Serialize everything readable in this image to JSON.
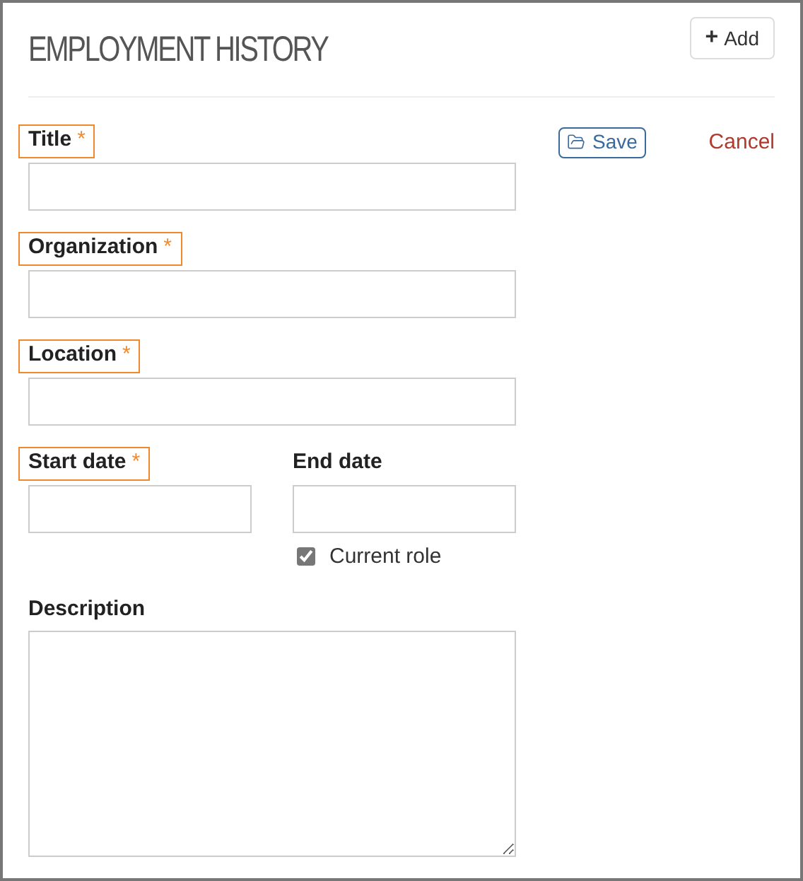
{
  "header": {
    "title": "EMPLOYMENT HISTORY",
    "add_button": {
      "icon": "+",
      "label": "Add"
    }
  },
  "required_mark": "*",
  "actions": {
    "save": "Save",
    "cancel": "Cancel"
  },
  "fields": [
    {
      "label": "Title",
      "required": true
    },
    {
      "label": "Organization",
      "required": true
    },
    {
      "label": "Location",
      "required": true
    }
  ],
  "dates": [
    {
      "label": "Start date",
      "required": true
    },
    {
      "label": "End date",
      "required": false
    }
  ],
  "current_role": {
    "label": "Current role",
    "checked": true
  },
  "description": {
    "label": "Description",
    "required": false
  }
}
